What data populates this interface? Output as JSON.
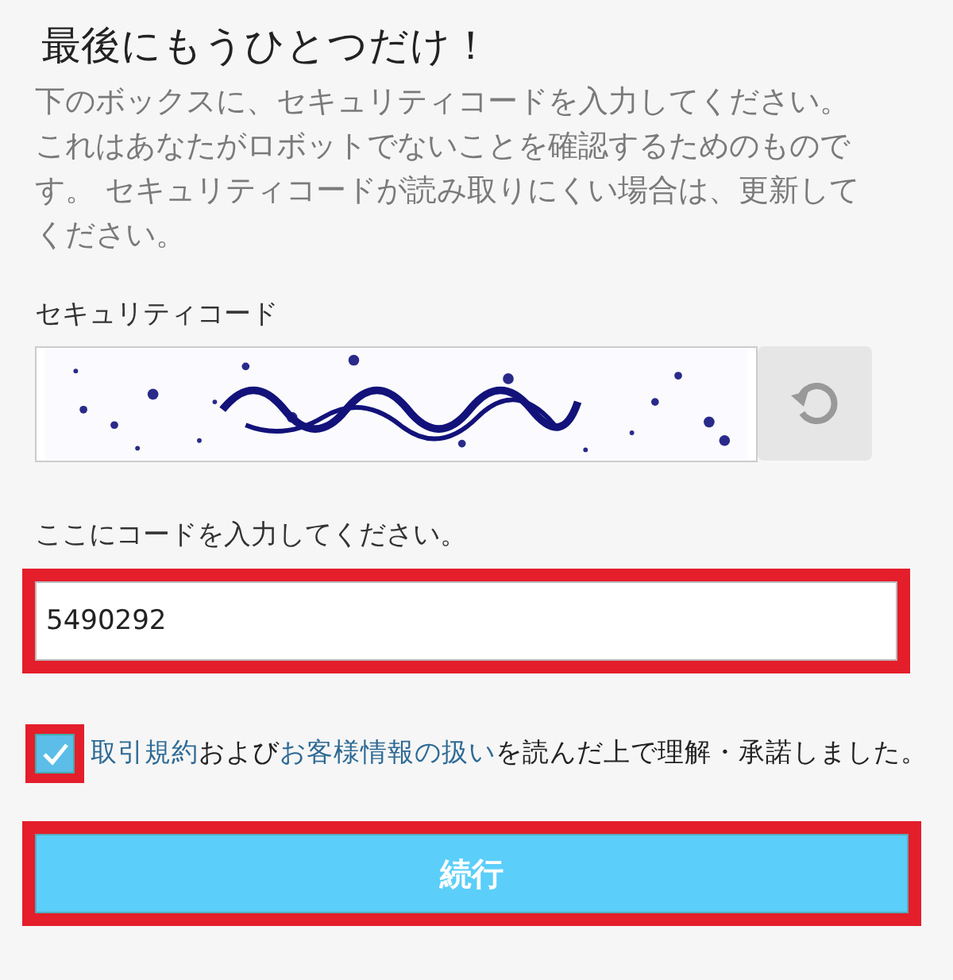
{
  "title": "最後にもうひとつだけ！",
  "description": "下のボックスに、セキュリティコードを入力してください。これはあなたがロボットでないことを確認するためのものです。 セキュリティコードが読み取りにくい場合は、更新してください。",
  "captcha": {
    "label": "セキュリティコード",
    "kind": "picture"
  },
  "code_field": {
    "label": "ここにコードを入力してください。",
    "value": "5490292",
    "highlighted": true
  },
  "consent": {
    "checked": true,
    "highlighted": true,
    "parts": [
      {
        "kind": "link",
        "text": "取引規約"
      },
      {
        "kind": "text",
        "text": "および"
      },
      {
        "kind": "link",
        "text": "お客様情報の扱い"
      },
      {
        "kind": "text",
        "text": "を読んだ上で理解・承諾しました。"
      }
    ]
  },
  "submit": {
    "label": "続行",
    "highlighted": true
  }
}
